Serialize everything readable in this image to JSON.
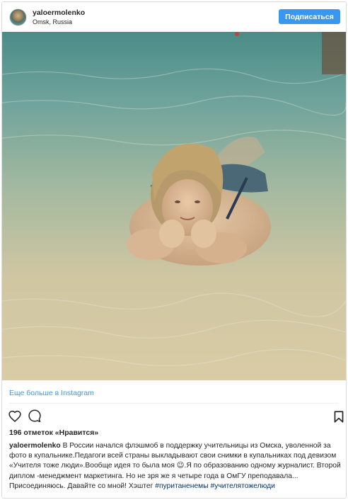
{
  "post": {
    "username": "yaloermolenko",
    "location": "Omsk, Russia",
    "follow_label": "Подписаться",
    "more_link": "Еще больше в Instagram",
    "likes_text": "196 отметок «Нравится»",
    "caption_text": "В России начался флэшмоб в поддержку учительницы из Омска, уволенной за фото в купальнике.Педагоги всей страны выкладывают свои снимки в купальниках под девизом «Учителя тоже люди».Вообще идея то была моя 😉.Я по образованию одному журналист. Второй диплом -менеджмент маркетинга. Но не зря же я четыре года в ОмГУ преподавала... Присоединяюсь. Давайте со мной! Хэштег ",
    "hashtag_1": "#пуританенемы",
    "hashtag_2": "#учителятожелюди"
  },
  "icons": {
    "like": "heart-outline-icon",
    "comment": "comment-bubble-icon",
    "save": "bookmark-icon"
  },
  "colors": {
    "follow_button": "#3897f0",
    "link": "#3897f0",
    "hashtag": "#003569",
    "text": "#262626"
  }
}
